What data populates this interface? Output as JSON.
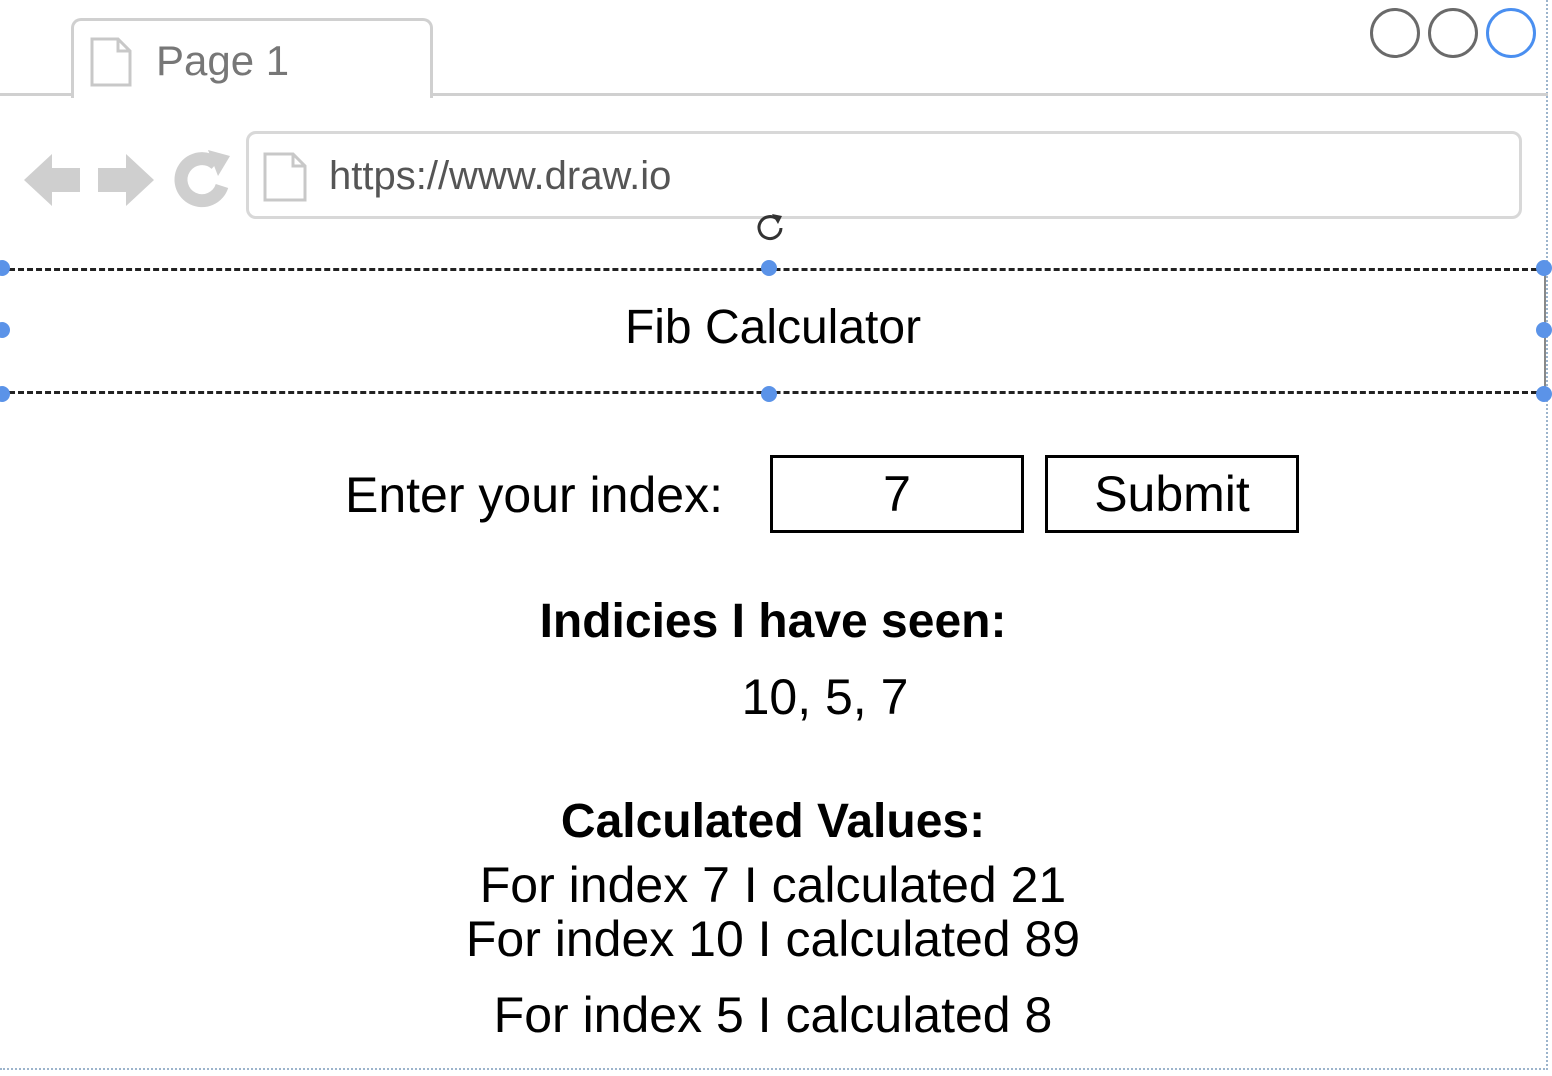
{
  "browser": {
    "tab_label": "Page 1",
    "url": "https://www.draw.io"
  },
  "icons": {
    "tab": "page-icon",
    "back": "back-arrow-icon",
    "forward": "forward-arrow-icon",
    "reload": "reload-icon",
    "url": "page-icon",
    "rotate": "rotate-handle-icon"
  },
  "colors": {
    "selection_handle": "#5b93e8",
    "active_window_control": "#4a8ff0",
    "chrome_gray": "#d0d0d0"
  },
  "app": {
    "title": "Fib Calculator",
    "form": {
      "label": "Enter your index:",
      "input_value": "7",
      "submit_label": "Submit"
    },
    "indices": {
      "heading": "Indicies I have seen:",
      "values": "10, 5, 7"
    },
    "calculated": {
      "heading": "Calculated Values:",
      "lines": [
        "For index 7 I calculated 21",
        "For index 10 I calculated 89",
        "For index 5 I calculated 8"
      ]
    }
  }
}
